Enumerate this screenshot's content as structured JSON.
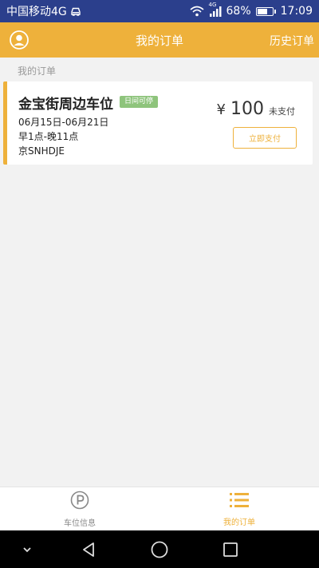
{
  "status_bar": {
    "carrier": "中国移动4G",
    "network": "4G",
    "battery": "68%",
    "battery_level": 0.68,
    "time": "17:09"
  },
  "header": {
    "title": "我的订单",
    "history": "历史订单"
  },
  "section_label": "我的订单",
  "order": {
    "title": "金宝街周边车位",
    "tag": "日间可停",
    "dates": "06月15日-06月21日",
    "hours": "早1点-晚11点",
    "plate": "京SNHDJE",
    "currency": "¥",
    "price": "100",
    "status": "未支付",
    "pay_label": "立即支付"
  },
  "tabs": [
    {
      "label": "车位信息",
      "icon": "parking-icon",
      "active": false
    },
    {
      "label": "我的订单",
      "icon": "list-icon",
      "active": true
    }
  ],
  "colors": {
    "accent": "#eeb13b",
    "status_bar": "#2b3f8c",
    "tag": "#8ec47c"
  }
}
